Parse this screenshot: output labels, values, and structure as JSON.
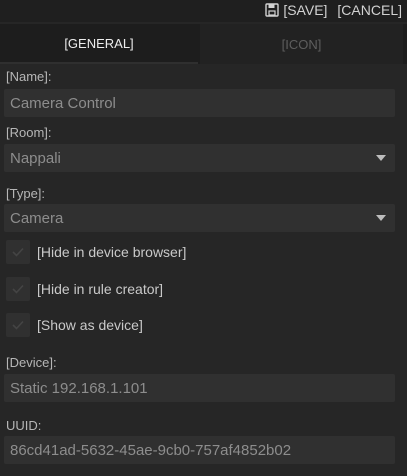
{
  "toolbar": {
    "save_label": "[SAVE]",
    "cancel_label": "[CANCEL]"
  },
  "tabs": [
    {
      "label": "[GENERAL]",
      "active": true
    },
    {
      "label": "[ICON]",
      "active": false
    }
  ],
  "form": {
    "name": {
      "label": "[Name]:",
      "value": "Camera Control"
    },
    "room": {
      "label": "[Room]:",
      "value": "Nappali"
    },
    "type": {
      "label": "[Type]:",
      "value": "Camera"
    },
    "checkboxes": [
      {
        "label": "[Hide in device browser]",
        "checked": true
      },
      {
        "label": "[Hide in rule creator]",
        "checked": true
      },
      {
        "label": "[Show as device]",
        "checked": true
      }
    ],
    "device": {
      "label": "[Device]:",
      "value": "Static 192.168.1.101"
    },
    "uuid": {
      "label": "UUID:",
      "value": "86cd41ad-5632-45ae-9cb0-757af4852b02"
    }
  },
  "icons": {
    "save": "floppy-disk-icon",
    "dropdown": "caret-down-icon",
    "check": "checkmark-icon"
  },
  "colors": {
    "background": "#262626",
    "field": "#303030",
    "tab_active_text": "#ededed",
    "tab_inactive_text": "#5e5e5e"
  }
}
